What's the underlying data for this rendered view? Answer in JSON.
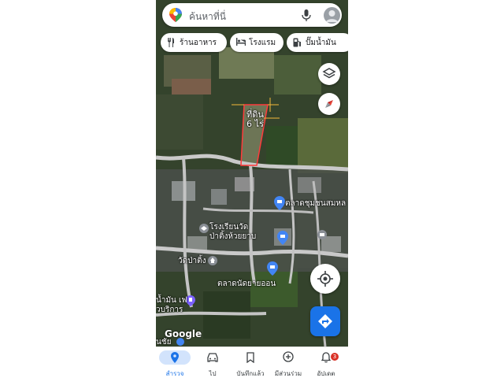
{
  "search": {
    "placeholder": "ค้นหาที่นี่"
  },
  "chips": [
    {
      "label": "ร้านอาหาร",
      "icon": "restaurant-icon"
    },
    {
      "label": "โรงแรม",
      "icon": "hotel-icon"
    },
    {
      "label": "ปั๊มน้ำมัน",
      "icon": "gas-station-icon"
    }
  ],
  "map": {
    "parcel_label_line1": "ที่ดิน",
    "parcel_label_line2": "6 ไร่",
    "places": [
      {
        "name": "ตลาดชุมชนสมหล"
      },
      {
        "name": "โรงเรียนวัด"
      },
      {
        "name": "ป่าติ้งห้วยยาบ"
      },
      {
        "name": "วัดป่าติ้ง"
      },
      {
        "name": "ตลาดนัดยายออน"
      },
      {
        "name": "น้ำมัน เฟ"
      },
      {
        "name": "วบริการ"
      },
      {
        "name": "นชัย"
      }
    ],
    "attribution": "Google",
    "colors": {
      "parcel_outline": "#ff3b3b",
      "marker_blue": "#4285f4",
      "accent": "#1a73e8"
    }
  },
  "nav": {
    "items": [
      {
        "label": "สำรวจ",
        "icon": "explore-pin-icon",
        "active": true
      },
      {
        "label": "ไป",
        "icon": "car-icon"
      },
      {
        "label": "บันทึกแล้ว",
        "icon": "bookmark-icon"
      },
      {
        "label": "มีส่วนร่วม",
        "icon": "add-circle-icon"
      },
      {
        "label": "อัปเดต",
        "icon": "bell-icon",
        "badge": "3"
      }
    ]
  }
}
